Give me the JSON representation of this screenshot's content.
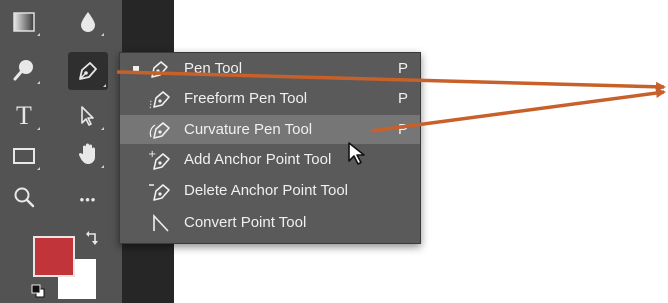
{
  "toolbar": {
    "tools": [
      {
        "name": "gradient-tool",
        "icon": "gradient-icon"
      },
      {
        "name": "blur-tool",
        "icon": "droplet-icon"
      },
      {
        "name": "dodge-tool",
        "icon": "dodge-icon"
      },
      {
        "name": "pen-tool",
        "icon": "pen-icon",
        "active": true
      },
      {
        "name": "type-tool",
        "icon": "type-icon",
        "glyph": "T"
      },
      {
        "name": "path-selection-tool",
        "icon": "arrow-icon"
      },
      {
        "name": "rectangle-tool",
        "icon": "rectangle-icon"
      },
      {
        "name": "hand-tool",
        "icon": "hand-icon"
      },
      {
        "name": "zoom-tool",
        "icon": "zoom-icon"
      },
      {
        "name": "more-tools",
        "icon": "more-icon",
        "glyph": "•••"
      }
    ],
    "foreground_color": "#c0343a",
    "background_color": "#ffffff"
  },
  "flyout": {
    "items": [
      {
        "label": "Pen Tool",
        "shortcut": "P",
        "icon": "pen-icon",
        "selected": true
      },
      {
        "label": "Freeform Pen Tool",
        "shortcut": "P",
        "icon": "freeform-pen-icon"
      },
      {
        "label": "Curvature Pen Tool",
        "shortcut": "P",
        "icon": "curvature-pen-icon",
        "hovered": true
      },
      {
        "label": "Add Anchor Point Tool",
        "shortcut": "",
        "icon": "add-anchor-point-icon"
      },
      {
        "label": "Delete Anchor Point Tool",
        "shortcut": "",
        "icon": "delete-anchor-point-icon"
      },
      {
        "label": "Convert Point Tool",
        "shortcut": "",
        "icon": "convert-point-icon"
      }
    ]
  },
  "annotation": {
    "arrow_color": "#c8602a"
  }
}
